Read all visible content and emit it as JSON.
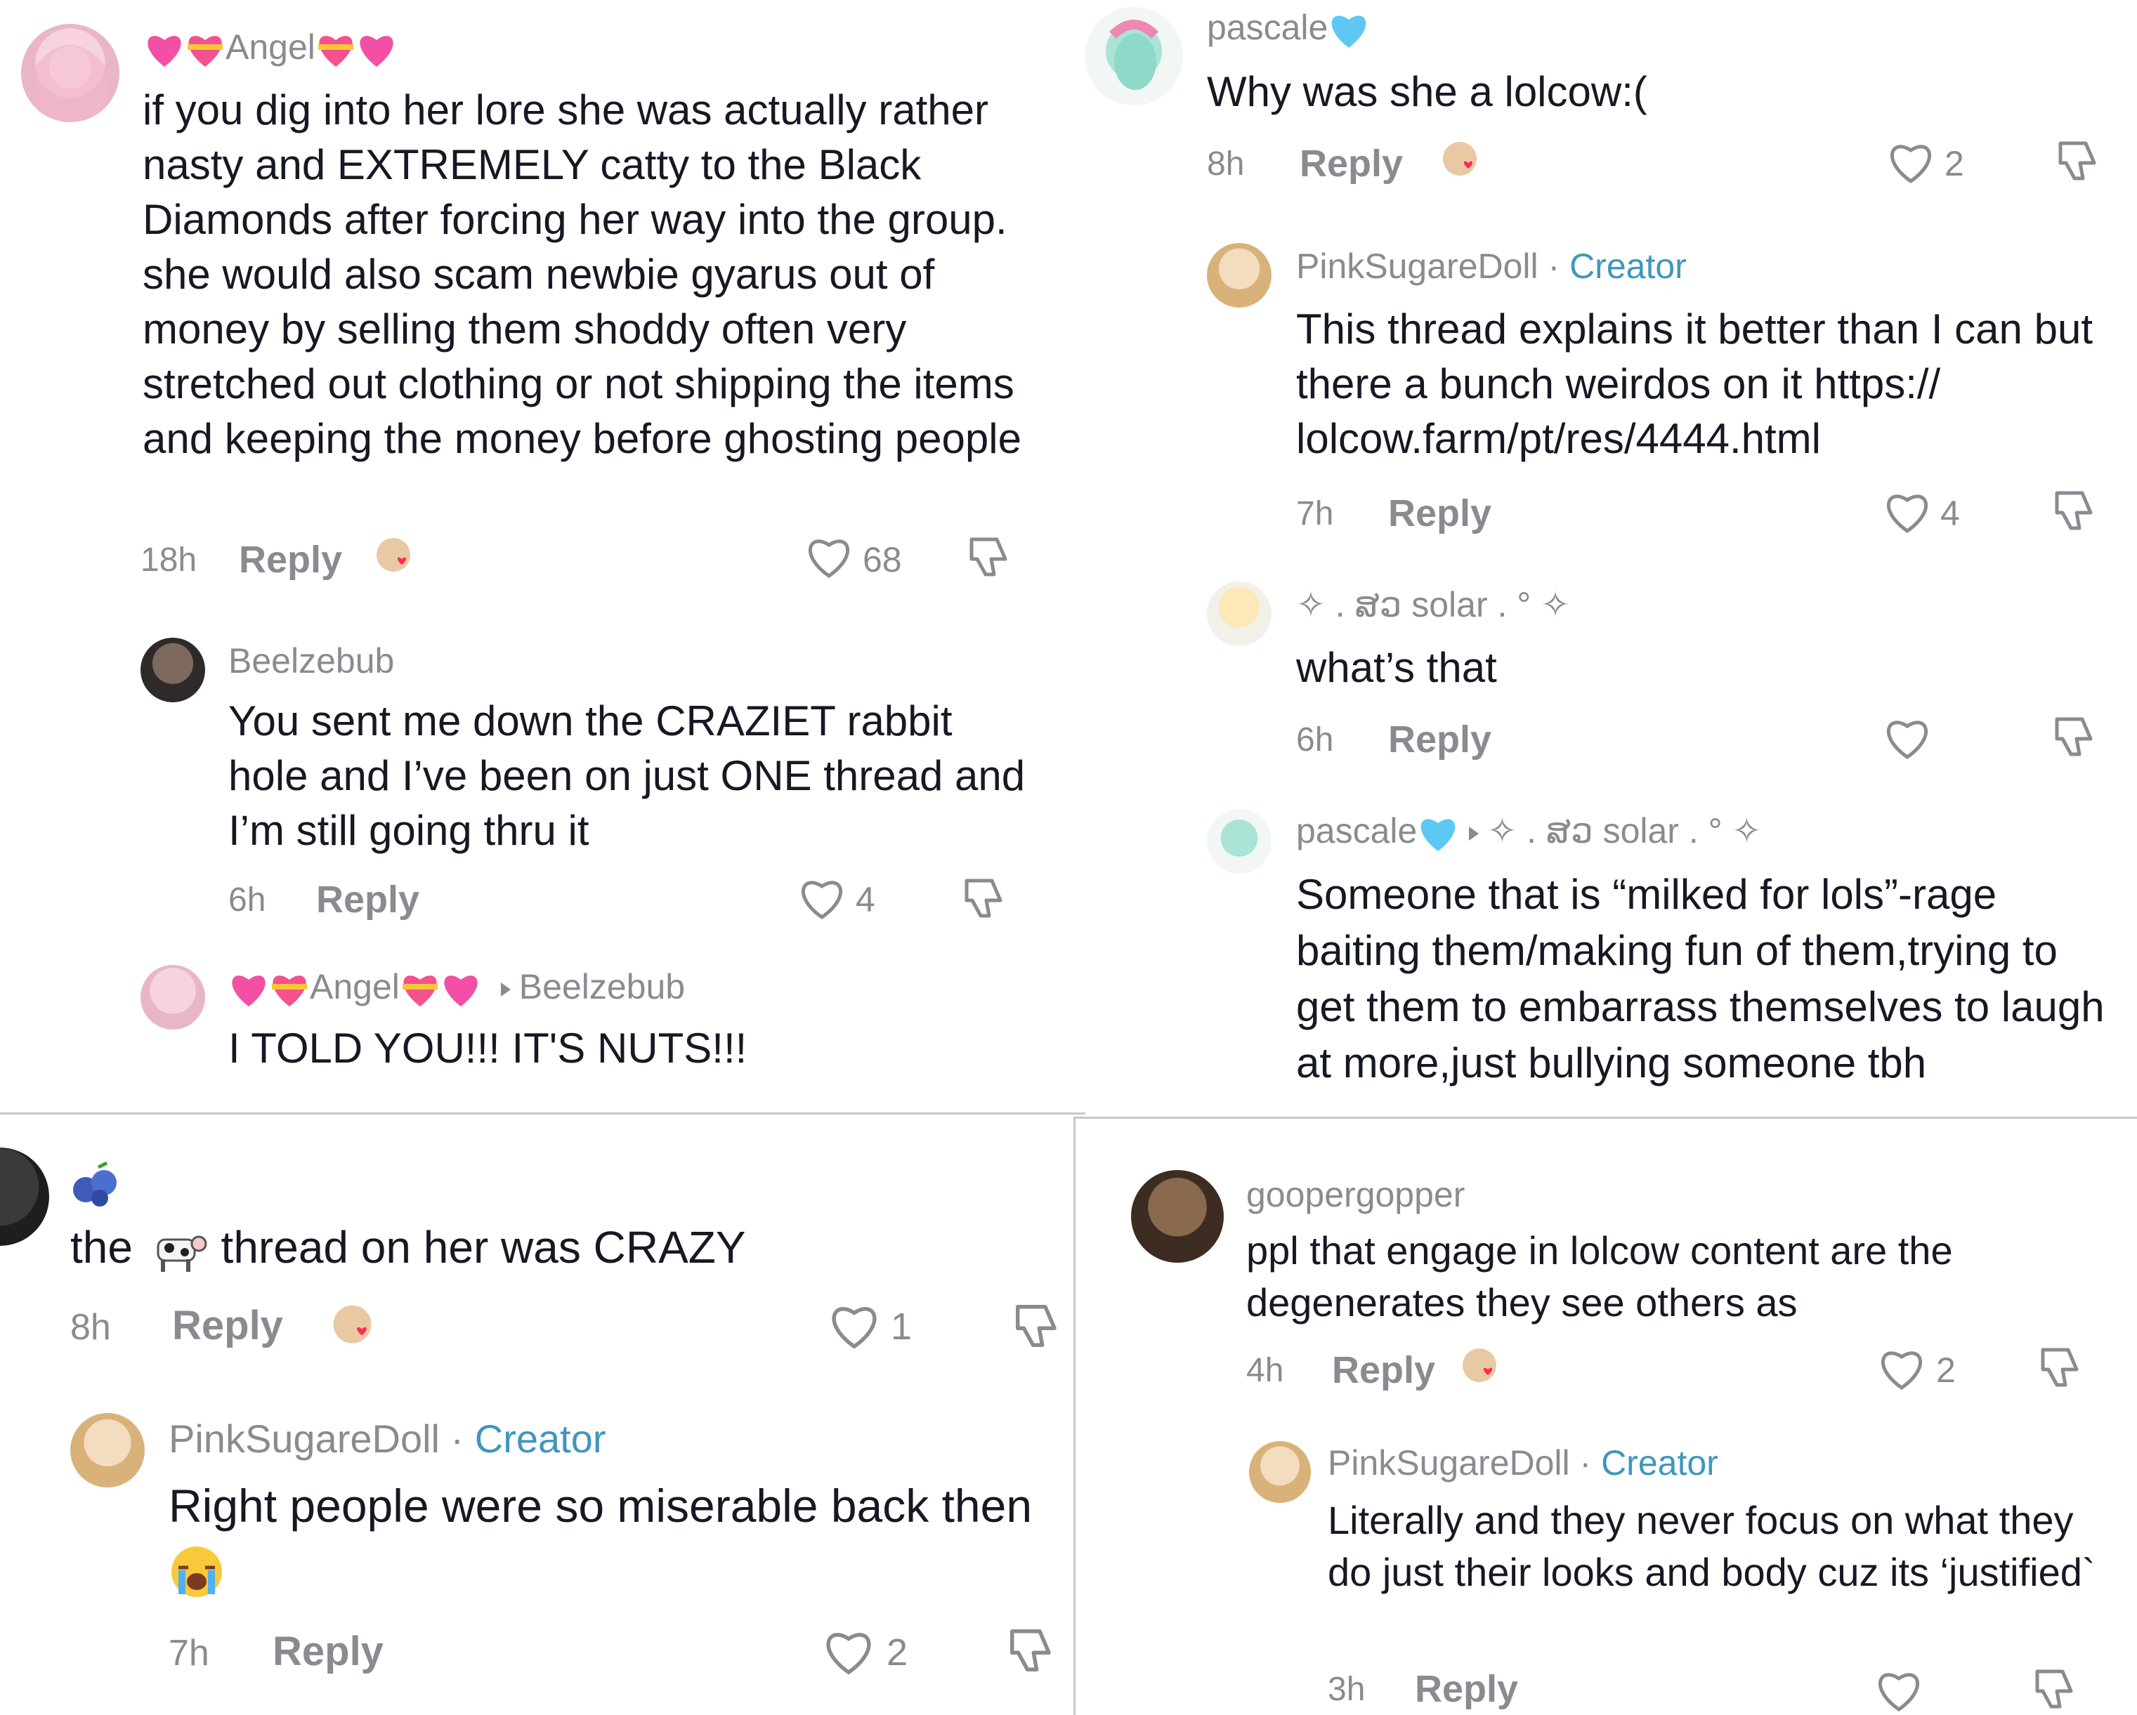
{
  "panel1": {
    "comment": {
      "username": "Angel",
      "text": "if you dig into her lore she was actually rather nasty and EXTREMELY catty to the Black Diamonds after forcing her way into the group. she would also scam newbie gyarus out of money by selling them shoddy often very stretched out clothing or not shipping the items and keeping the money before ghosting people",
      "time": "18h",
      "reply": "Reply",
      "likes": "68"
    },
    "reply1": {
      "username": "Beelzebub",
      "text": "You sent me down the CRAZIET rabbit hole and I’ve been on just ONE thread and I’m still going thru it",
      "time": "6h",
      "reply": "Reply",
      "likes": "4"
    },
    "reply2": {
      "username": "Angel",
      "reply_to": "Beelzebub",
      "text": "I TOLD YOU!!! IT'S NUTS!!!"
    }
  },
  "panel2": {
    "comment": {
      "username": "pascale",
      "text": "Why was she a lolcow:(",
      "time": "8h",
      "reply": "Reply",
      "likes": "2"
    },
    "reply1": {
      "username": "PinkSugareDoll",
      "badge": "Creator",
      "separator": " · ",
      "text": "This thread explains it better than I can but there a bunch weirdos on it https:// lolcow.farm/pt/res/4444.html",
      "time": "7h",
      "reply": "Reply",
      "likes": "4"
    },
    "reply2": {
      "username": "✧ . ສວ solar . ° ✧",
      "text": "what’s that",
      "time": "6h",
      "reply": "Reply"
    },
    "reply3": {
      "username": "pascale",
      "reply_to": "✧ . ສວ solar . ° ✧",
      "text": "Someone that is “milked for lols”-rage baiting them/making fun of them,trying to get them to embarrass themselves to laugh at more,just bullying someone tbh"
    }
  },
  "panel3": {
    "comment": {
      "text_before": "the",
      "text_after": "thread on her was CRAZY",
      "time": "8h",
      "reply": "Reply",
      "likes": "1"
    },
    "reply1": {
      "username": "PinkSugareDoll",
      "badge": "Creator",
      "separator": " · ",
      "text": "Right people were so miserable back then",
      "time": "7h",
      "reply": "Reply",
      "likes": "2"
    }
  },
  "panel4": {
    "comment": {
      "username": "goopergopper",
      "text": "ppl that engage in lolcow content are the degenerates they see others as",
      "time": "4h",
      "reply": "Reply",
      "likes": "2"
    },
    "reply1": {
      "username": "PinkSugareDoll",
      "badge": "Creator",
      "separator": " · ",
      "text": "Literally and they never focus on what they do just their looks and body cuz its ‘justified`",
      "time": "3h",
      "reply": "Reply"
    }
  },
  "icons": {
    "heart": "heart-outline-icon",
    "dislike": "thumbs-down-icon",
    "creator_liked": "creator-liked-avatar-icon",
    "reply_arrow": "reply-arrow-icon"
  },
  "colors": {
    "text": "#161823",
    "muted": "#8a8b91",
    "creator": "#3f96bd",
    "liked_heart": "#fe2c55",
    "blue_heart": "#5ec8f5"
  }
}
